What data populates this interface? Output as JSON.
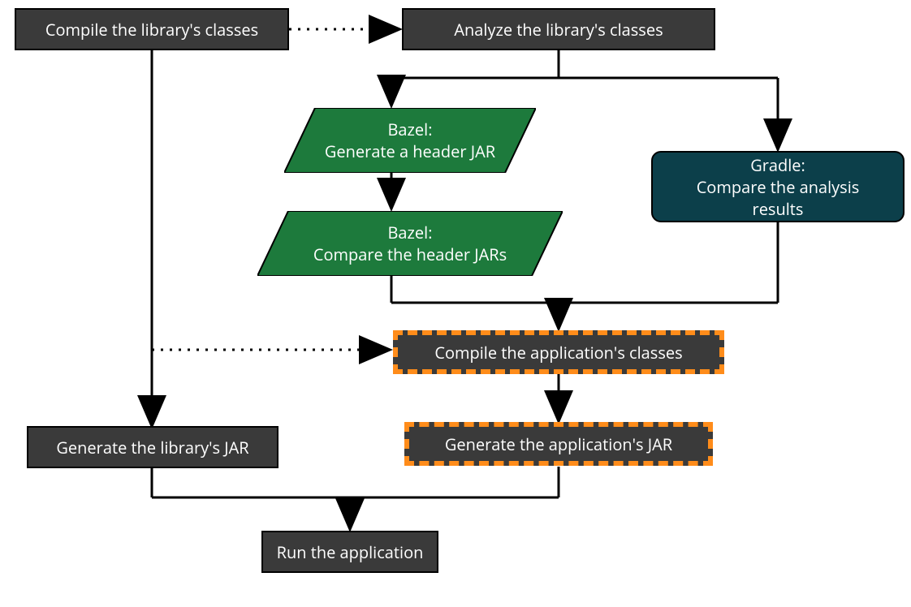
{
  "nodes": {
    "compile_lib": "Compile the library's classes",
    "analyze_lib": "Analyze the library's classes",
    "bazel_gen_header": {
      "line1": "Bazel:",
      "line2": "Generate a header JAR"
    },
    "bazel_compare_header": {
      "line1": "Bazel:",
      "line2": "Compare the header JARs"
    },
    "gradle_compare": {
      "line1": "Gradle:",
      "line2": "Compare the analysis results"
    },
    "compile_app": "Compile the application's classes",
    "gen_lib_jar": "Generate the library's JAR",
    "gen_app_jar": "Generate the application's JAR",
    "run_app": "Run the application"
  }
}
